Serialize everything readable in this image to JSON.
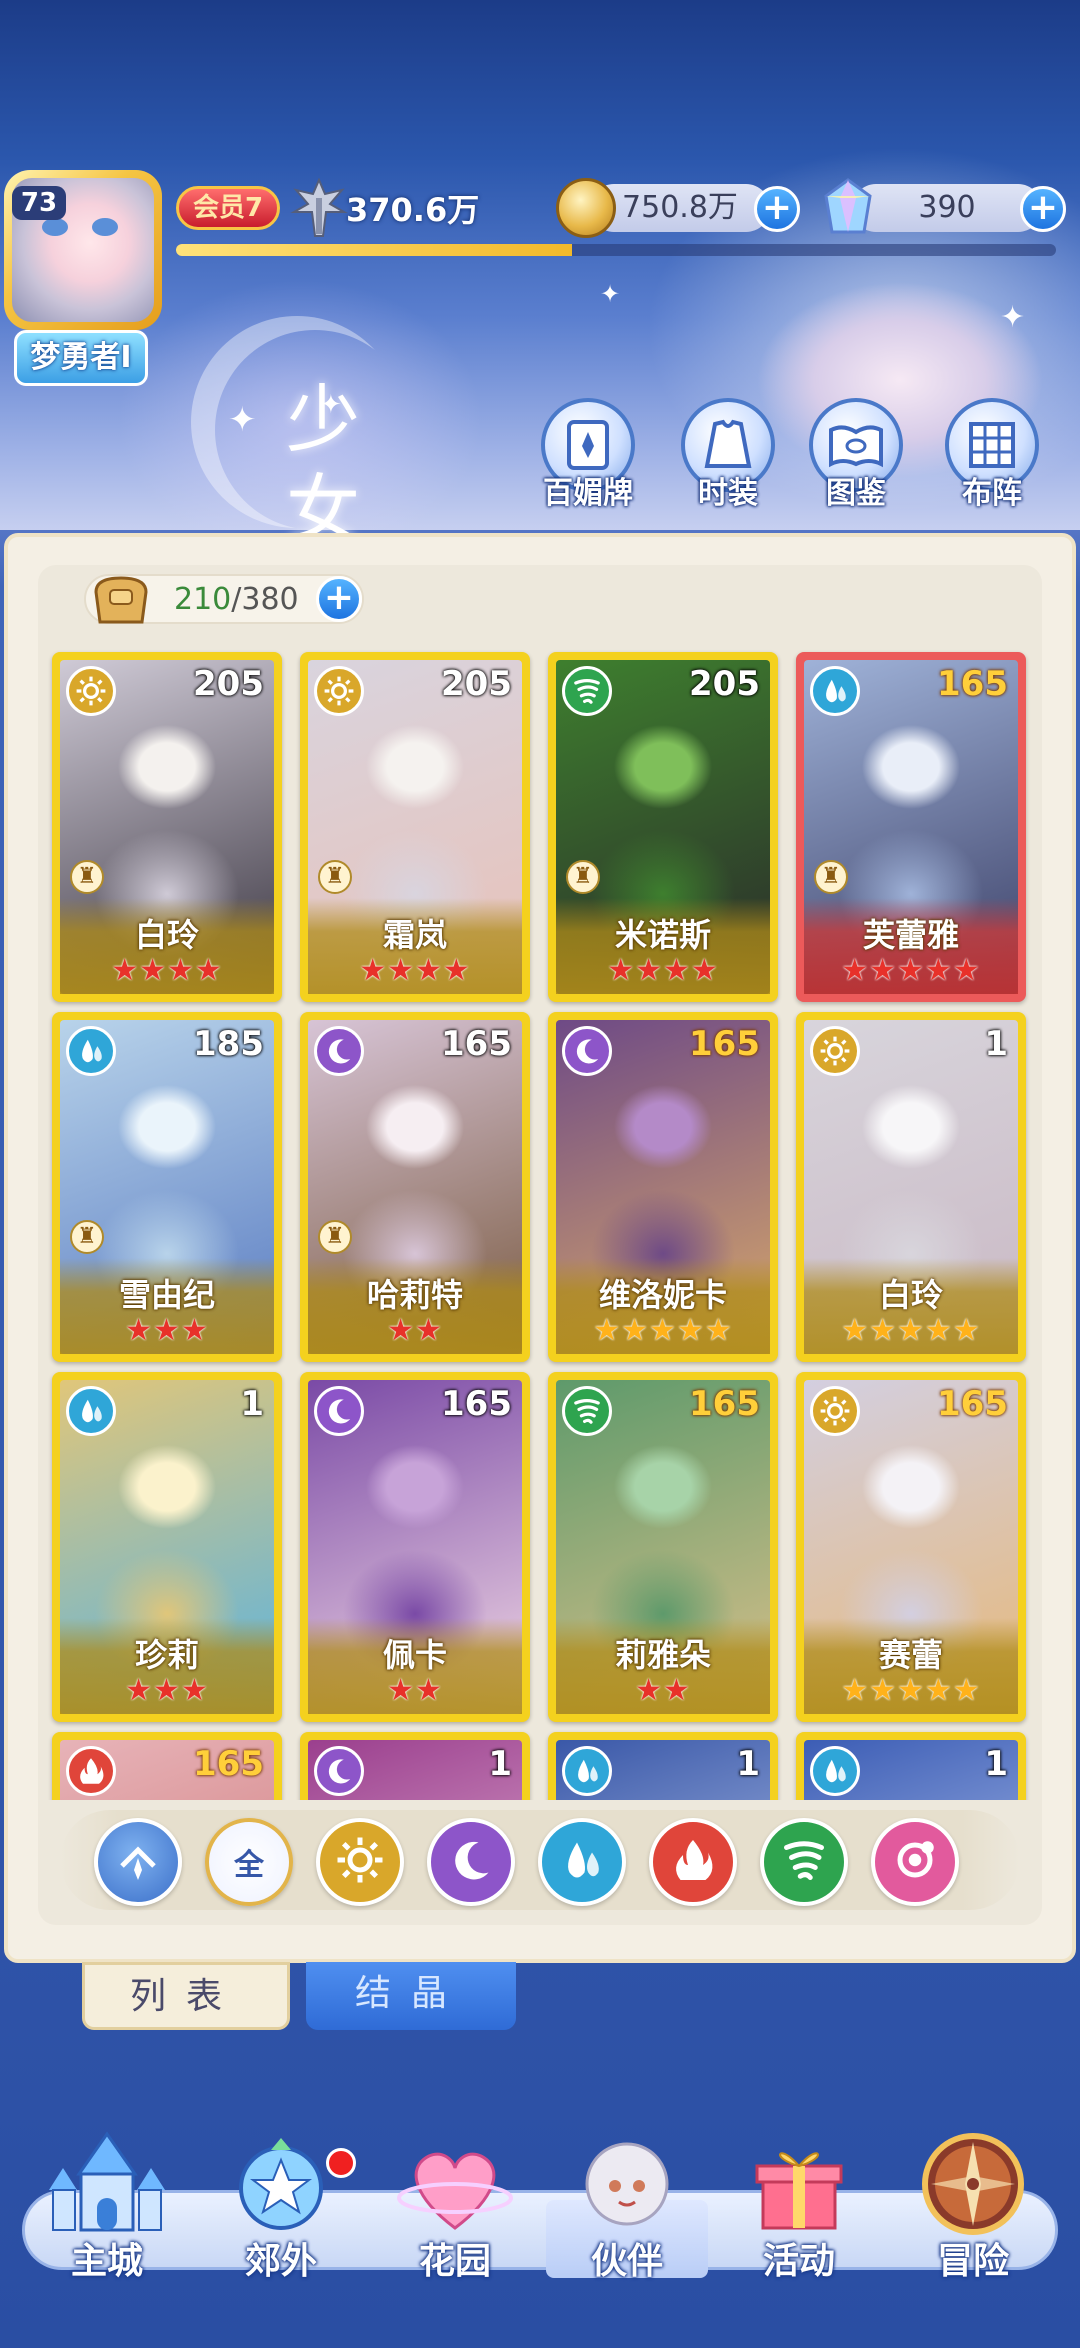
{
  "player": {
    "level": "73",
    "name": "梦勇者I",
    "vip": "会员7",
    "power": "370.6万",
    "gold": "750.8万",
    "gems": "390",
    "exp_progress": 0.45
  },
  "section": {
    "title": "少女",
    "nav": [
      {
        "label": "百媚牌",
        "icon": "card-deck-icon"
      },
      {
        "label": "时装",
        "icon": "costume-icon"
      },
      {
        "label": "图鉴",
        "icon": "codex-book-icon"
      },
      {
        "label": "布阵",
        "icon": "formation-grid-icon"
      }
    ]
  },
  "inventory": {
    "current": "210",
    "max": "/380"
  },
  "element_colors": {
    "light": "#d9a72a",
    "water": "#2fa6d8",
    "wind": "#2ea44f",
    "moon": "#8d55c9",
    "fire": "#e0453a",
    "star": "#e25a9d"
  },
  "cards": [
    {
      "name": "白玲",
      "level": "205",
      "element": "light",
      "stars": 4,
      "star_color": "red",
      "rook": true,
      "frame": "gold",
      "level_color": "white"
    },
    {
      "name": "霜岚",
      "level": "205",
      "element": "light",
      "stars": 4,
      "star_color": "red",
      "rook": true,
      "frame": "gold",
      "level_color": "white"
    },
    {
      "name": "米诺斯",
      "level": "205",
      "element": "wind",
      "stars": 4,
      "star_color": "red",
      "rook": true,
      "frame": "gold",
      "level_color": "white"
    },
    {
      "name": "芙蕾雅",
      "level": "165",
      "element": "water",
      "stars": 5,
      "star_color": "red",
      "rook": true,
      "frame": "red",
      "level_color": "gold"
    },
    {
      "name": "雪由纪",
      "level": "185",
      "element": "water",
      "stars": 3,
      "star_color": "red",
      "rook": true,
      "frame": "gold",
      "level_color": "white"
    },
    {
      "name": "哈莉特",
      "level": "165",
      "element": "moon",
      "stars": 2,
      "star_color": "red",
      "rook": true,
      "frame": "gold",
      "level_color": "white"
    },
    {
      "name": "维洛妮卡",
      "level": "165",
      "element": "moon",
      "stars": 5,
      "star_color": "gold",
      "rook": false,
      "frame": "gold",
      "level_color": "gold"
    },
    {
      "name": "白玲",
      "level": "1",
      "element": "light",
      "stars": 5,
      "star_color": "gold",
      "rook": false,
      "frame": "gold",
      "level_color": "white"
    },
    {
      "name": "珍莉",
      "level": "1",
      "element": "water",
      "stars": 3,
      "star_color": "red",
      "rook": false,
      "frame": "gold",
      "level_color": "white"
    },
    {
      "name": "佩卡",
      "level": "165",
      "element": "moon",
      "stars": 2,
      "star_color": "red",
      "rook": false,
      "frame": "gold",
      "level_color": "white"
    },
    {
      "name": "莉雅朵",
      "level": "165",
      "element": "wind",
      "stars": 2,
      "star_color": "red",
      "rook": false,
      "frame": "gold",
      "level_color": "gold"
    },
    {
      "name": "赛蕾",
      "level": "165",
      "element": "light",
      "stars": 5,
      "star_color": "gold",
      "rook": false,
      "frame": "gold",
      "level_color": "gold"
    },
    {
      "name": "",
      "level": "165",
      "element": "fire",
      "stars": 0,
      "star_color": "red",
      "rook": false,
      "frame": "gold",
      "level_color": "gold"
    },
    {
      "name": "",
      "level": "1",
      "element": "moon",
      "stars": 0,
      "star_color": "red",
      "rook": false,
      "frame": "gold",
      "level_color": "white"
    },
    {
      "name": "",
      "level": "1",
      "element": "water",
      "stars": 0,
      "star_color": "red",
      "rook": false,
      "frame": "gold",
      "level_color": "white"
    },
    {
      "name": "",
      "level": "1",
      "element": "water",
      "stars": 0,
      "star_color": "red",
      "rook": false,
      "frame": "gold",
      "level_color": "white"
    }
  ],
  "filters": [
    {
      "id": "collapse",
      "icon": "collapse-up-icon",
      "label": ""
    },
    {
      "id": "all",
      "icon": "all-filter-icon",
      "label": "全"
    },
    {
      "id": "light",
      "icon": "light-element-icon",
      "label": ""
    },
    {
      "id": "moon",
      "icon": "moon-element-icon",
      "label": ""
    },
    {
      "id": "water",
      "icon": "water-element-icon",
      "label": ""
    },
    {
      "id": "fire",
      "icon": "fire-element-icon",
      "label": ""
    },
    {
      "id": "wind",
      "icon": "wind-element-icon",
      "label": ""
    },
    {
      "id": "star",
      "icon": "star-element-icon",
      "label": ""
    }
  ],
  "tabs": {
    "list": "列表",
    "crystal": "结晶"
  },
  "bottom_nav": [
    {
      "label": "主城",
      "icon": "castle-icon"
    },
    {
      "label": "郊外",
      "icon": "outskirts-icon"
    },
    {
      "label": "花园",
      "icon": "garden-heart-icon"
    },
    {
      "label": "伙伴",
      "icon": "partner-avatar-icon"
    },
    {
      "label": "活动",
      "icon": "gift-box-icon"
    },
    {
      "label": "冒险",
      "icon": "compass-icon"
    }
  ]
}
